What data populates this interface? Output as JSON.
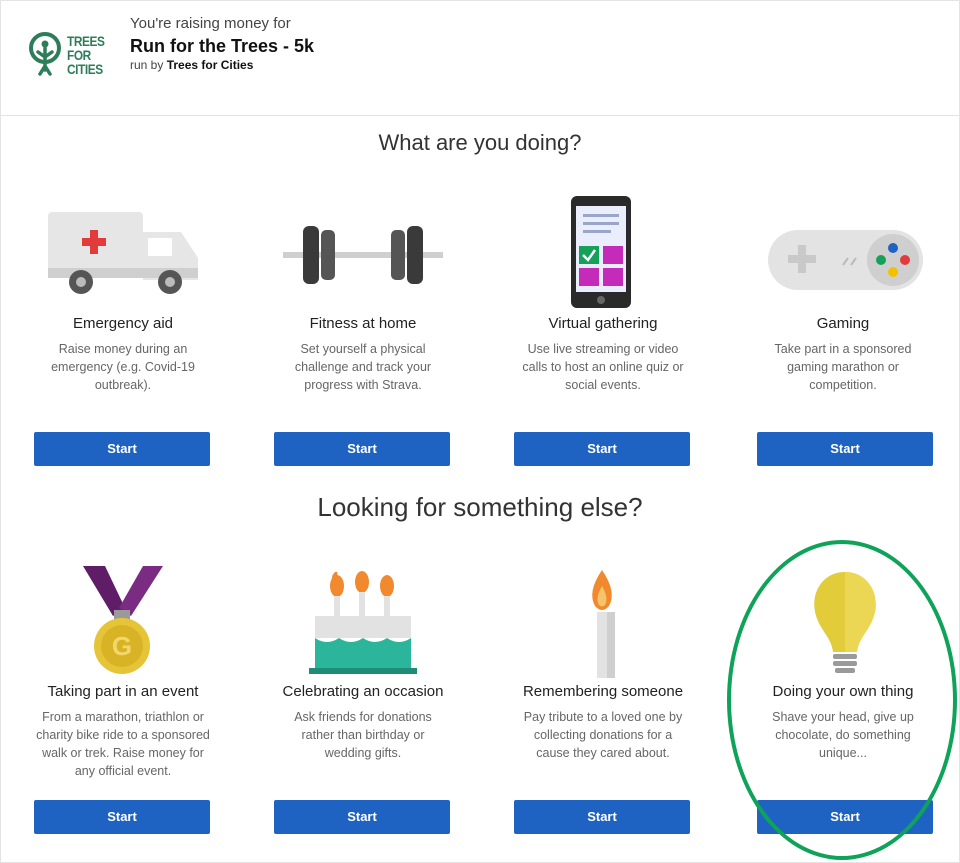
{
  "header": {
    "logo_text": "TREES FOR CITIES",
    "raising_label": "You're raising money for",
    "campaign_title": "Run for the Trees - 5k",
    "run_by_prefix": "run by",
    "run_by_org": "Trees for Cities"
  },
  "section1": {
    "title": "What are you doing?",
    "cards": [
      {
        "title": "Emergency aid",
        "desc": "Raise money during an emergency (e.g. Covid-19 outbreak).",
        "button": "Start",
        "icon": "ambulance-icon"
      },
      {
        "title": "Fitness at home",
        "desc": "Set yourself a physical challenge and track your progress with Strava.",
        "button": "Start",
        "icon": "dumbbell-icon"
      },
      {
        "title": "Virtual gathering",
        "desc": "Use live streaming or video calls to host an online quiz or social events.",
        "button": "Start",
        "icon": "smartphone-icon"
      },
      {
        "title": "Gaming",
        "desc": "Take part in a sponsored gaming marathon or competition.",
        "button": "Start",
        "icon": "gamepad-icon"
      }
    ]
  },
  "section2": {
    "title": "Looking for something else?",
    "cards": [
      {
        "title": "Taking part in an event",
        "desc": "From a marathon, triathlon or charity bike ride to a sponsored walk or trek. Raise money for any official event.",
        "button": "Start",
        "icon": "medal-icon"
      },
      {
        "title": "Celebrating an occasion",
        "desc": "Ask friends for donations rather than birthday or wedding gifts.",
        "button": "Start",
        "icon": "cake-icon"
      },
      {
        "title": "Remembering someone",
        "desc": "Pay tribute to a loved one by collecting donations for a cause they cared about.",
        "button": "Start",
        "icon": "candle-icon"
      },
      {
        "title": "Doing your own thing",
        "desc": "Shave your head, give up chocolate, do something unique...",
        "button": "Start",
        "icon": "lightbulb-icon"
      }
    ]
  },
  "colors": {
    "button": "#1f63c2",
    "brand_green": "#2e7d5a",
    "highlight": "#0fa35a"
  }
}
